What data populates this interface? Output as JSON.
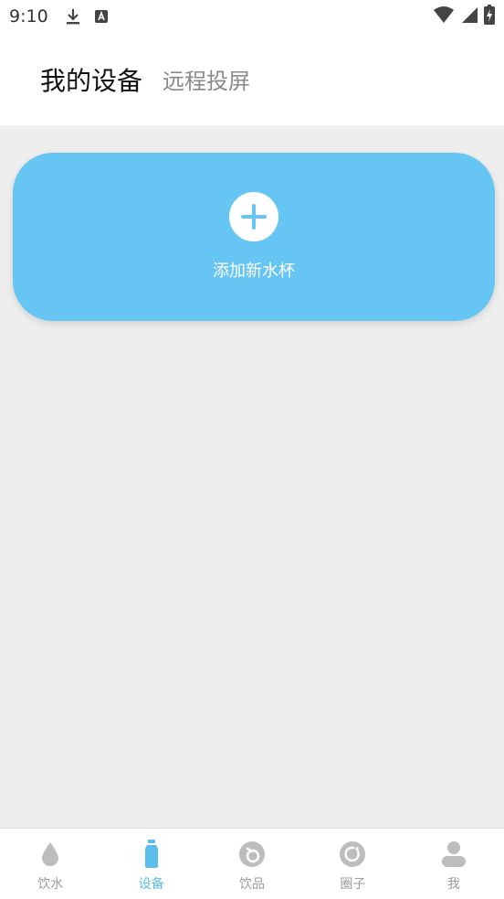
{
  "status_bar": {
    "time": "9:10"
  },
  "header": {
    "tabs": [
      {
        "label": "我的设备",
        "active": true
      },
      {
        "label": "远程投屏",
        "active": false
      }
    ]
  },
  "add_card": {
    "label": "添加新水杯",
    "icon": "plus-icon"
  },
  "bottom_nav": {
    "items": [
      {
        "label": "饮水",
        "icon": "water-drop-icon",
        "active": false
      },
      {
        "label": "设备",
        "icon": "bottle-icon",
        "active": true
      },
      {
        "label": "饮品",
        "icon": "drink-icon",
        "active": false
      },
      {
        "label": "圈子",
        "icon": "circle-icon",
        "active": false
      },
      {
        "label": "我",
        "icon": "person-icon",
        "active": false
      }
    ]
  },
  "colors": {
    "accent": "#66c5f2",
    "active_nav": "#5bbde9",
    "inactive_nav": "#bdbdbd",
    "background": "#eeeeee"
  }
}
